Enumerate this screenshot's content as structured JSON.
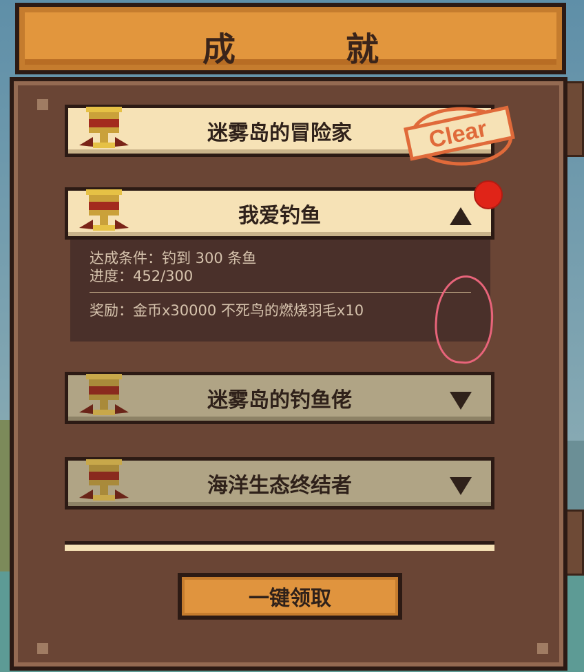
{
  "title": "成　就",
  "achievements": [
    {
      "label": "迷雾岛的冒险家",
      "state": "cleared"
    },
    {
      "label": "我爱钓鱼",
      "state": "expanded",
      "arrow": "up-arrow-icon"
    },
    {
      "label": "迷雾岛的钓鱼佬",
      "state": "collapsed",
      "arrow": "down-arrow-icon"
    },
    {
      "label": "海洋生态终结者",
      "state": "collapsed",
      "arrow": "down-arrow-icon"
    }
  ],
  "details": {
    "condition": "达成条件：钓到 300 条鱼",
    "progress": "进度：452/300",
    "reward": "奖励：金币x30000 不死鸟的燃烧羽毛x10"
  },
  "stamp_text": "Clear",
  "claim_button": "一键领取",
  "colors": {
    "title_bar": "#e2963d",
    "panel": "#6a4535",
    "row_light": "#f6e2b6",
    "row_dark": "#b0a485",
    "badge": "#e02418",
    "stamp": "#e06a3a"
  }
}
